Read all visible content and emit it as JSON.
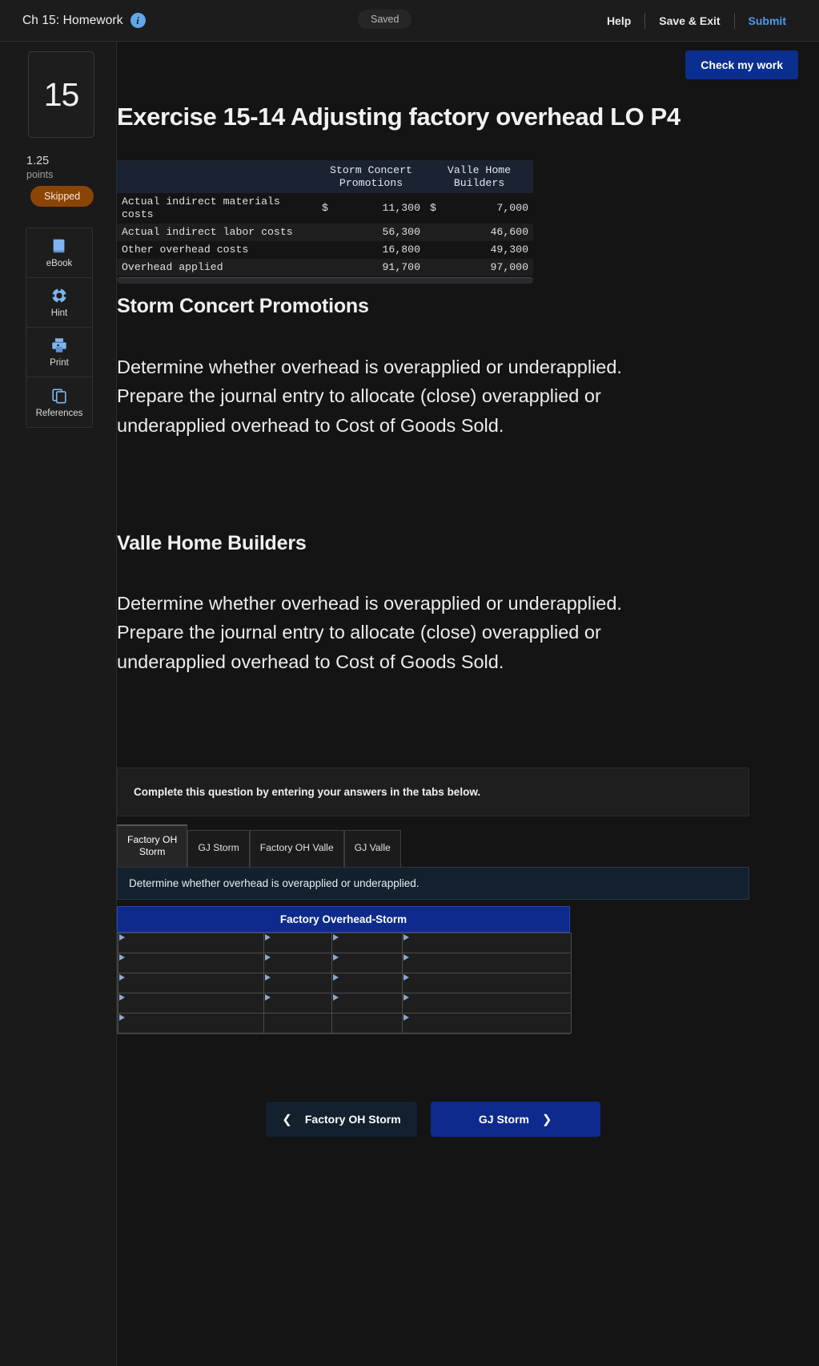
{
  "topbar": {
    "course_title": "Ch 15: Homework",
    "info_icon": "info-icon",
    "saved_status": "Saved",
    "help_label": "Help",
    "save_exit_label": "Save & Exit",
    "submit_label": "Submit",
    "accent_color": "#4d9bf0"
  },
  "sidebar": {
    "question_number": "15",
    "points_value": "1.25",
    "points_label": "points",
    "status_badge": "Skipped",
    "status_badge_color": "#8a4505",
    "tools": [
      {
        "label": "eBook",
        "icon": "book-icon"
      },
      {
        "label": "Hint",
        "icon": "lifebuoy-icon"
      },
      {
        "label": "Print",
        "icon": "printer-icon"
      },
      {
        "label": "References",
        "icon": "copy-pages-icon"
      }
    ]
  },
  "content": {
    "check_work_label": "Check my work",
    "exercise_title": "Exercise 15-14 Adjusting factory overhead LO P4",
    "sections": [
      {
        "heading": "Storm Concert Promotions",
        "body": "Determine whether overhead is overapplied or underapplied.\nPrepare the journal entry to allocate (close) overapplied or underapplied overhead to Cost of Goods Sold."
      },
      {
        "heading": "Valle Home Builders",
        "body": "Determine whether overhead is overapplied or underapplied.\nPrepare the journal entry to allocate (close) overapplied or underapplied overhead to Cost of Goods Sold."
      }
    ]
  },
  "fin_table": {
    "columns": [
      "",
      "Storm Concert\nPromotions",
      "Valle Home\nBuilders"
    ],
    "rows": [
      {
        "label": "Actual indirect materials costs",
        "storm_symbol": "$",
        "storm": "11,300",
        "valle_symbol": "$",
        "valle": "7,000"
      },
      {
        "label": "Actual indirect labor costs",
        "storm_symbol": "",
        "storm": "56,300",
        "valle_symbol": "",
        "valle": "46,600"
      },
      {
        "label": "Other overhead costs",
        "storm_symbol": "",
        "storm": "16,800",
        "valle_symbol": "",
        "valle": "49,300"
      },
      {
        "label": "Overhead applied",
        "storm_symbol": "",
        "storm": "91,700",
        "valle_symbol": "",
        "valle": "97,000"
      }
    ]
  },
  "answer_panel": {
    "instruction": "Complete this question by entering your answers in the tabs below.",
    "tabs": [
      {
        "label": "Factory OH Storm",
        "active": true
      },
      {
        "label": "GJ Storm",
        "active": false
      },
      {
        "label": "Factory OH Valle",
        "active": false
      },
      {
        "label": "GJ Valle",
        "active": false
      }
    ],
    "tab_instruction": "Determine whether overhead is overapplied or underapplied.",
    "grid_title": "Factory Overhead-Storm",
    "grid_accent_color": "#0d2a8c",
    "grid_rows": 5,
    "grid_cols": 4,
    "grid_values": [
      [
        "",
        "",
        "",
        ""
      ],
      [
        "",
        "",
        "",
        ""
      ],
      [
        "",
        "",
        "",
        ""
      ],
      [
        "",
        "",
        "",
        ""
      ],
      [
        "",
        "",
        "",
        ""
      ]
    ],
    "nav_prev_label": "Factory OH Storm",
    "nav_prev_icon": "chevron-left-icon",
    "nav_next_label": "GJ Storm",
    "nav_next_icon": "chevron-right-icon"
  }
}
